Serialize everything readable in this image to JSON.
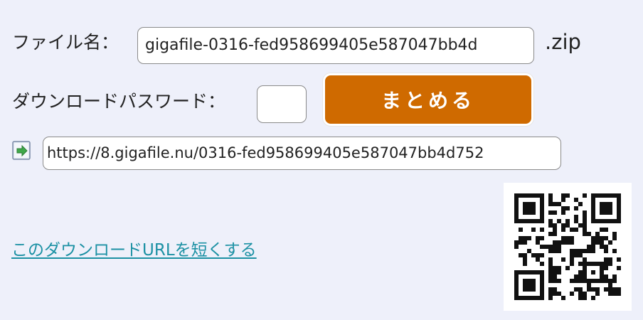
{
  "form": {
    "filename_label": "ファイル名：",
    "filename_value": "gigafile-0316-fed958699405e587047bb4d",
    "extension": ".zip",
    "password_label": "ダウンロードパスワード：",
    "password_value": "",
    "submit_label": "まとめる"
  },
  "download": {
    "url": "https://8.gigafile.nu/0316-fed958699405e587047bb4d752",
    "shorten_link": "このダウンロードURLを短くする",
    "icon": "link-arrow-icon",
    "qr_icon": "qr-code-icon"
  },
  "colors": {
    "background": "#eef0fa",
    "button": "#cf6a00",
    "link": "#1c91a4"
  }
}
